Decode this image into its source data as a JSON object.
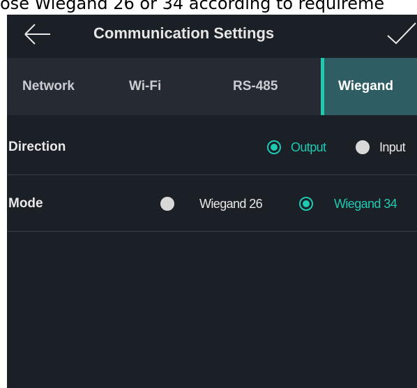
{
  "caption": "ose Wiegand 26 or 34 according to requireme",
  "header": {
    "title": "Communication Settings",
    "back_icon": "arrow-left-icon",
    "confirm_icon": "checkmark-icon"
  },
  "tabs": [
    {
      "label": "Network",
      "active": false
    },
    {
      "label": "Wi-Fi",
      "active": false
    },
    {
      "label": "RS-485",
      "active": false
    },
    {
      "label": "Wiegand",
      "active": true
    }
  ],
  "settings": {
    "direction": {
      "label": "Direction",
      "options": [
        {
          "label": "Output",
          "selected": true
        },
        {
          "label": "Input",
          "selected": false
        }
      ]
    },
    "mode": {
      "label": "Mode",
      "options": [
        {
          "label": "Wiegand 26",
          "selected": false
        },
        {
          "label": "Wiegand 34",
          "selected": true
        }
      ]
    }
  },
  "colors": {
    "accent": "#1fc9b2",
    "background": "#1b1f26",
    "tab_bar": "#262b33",
    "active_tab": "#2e5e63"
  }
}
